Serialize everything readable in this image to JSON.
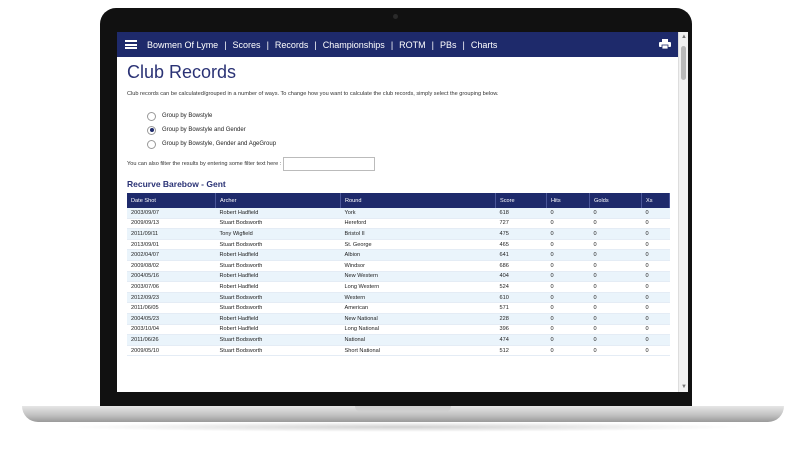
{
  "nav": {
    "brand": "Bowmen Of Lyme",
    "items": [
      "Scores",
      "Records",
      "Championships",
      "ROTM",
      "PBs",
      "Charts"
    ]
  },
  "page": {
    "title": "Club Records",
    "intro": "Club records can be calculated/grouped in a number of ways. To change how you want to calculate the club records, simply select the grouping below."
  },
  "grouping": {
    "options": [
      {
        "label": "Group by Bowstyle",
        "selected": false
      },
      {
        "label": "Group by Bowstyle and Gender",
        "selected": true
      },
      {
        "label": "Group by Bowstyle, Gender and AgeGroup",
        "selected": false
      }
    ]
  },
  "filter": {
    "label": "You can also filter the results by entering some filter text here :",
    "value": ""
  },
  "section": {
    "title": "Recurve Barebow - Gent"
  },
  "table": {
    "columns": [
      "Date Shot",
      "Archer",
      "Round",
      "Score",
      "Hits",
      "Golds",
      "Xs"
    ],
    "rows": [
      [
        "2003/09/07",
        "Robert Hadfield",
        "York",
        "618",
        "0",
        "0",
        "0"
      ],
      [
        "2009/09/13",
        "Stuart Bodsworth",
        "Hereford",
        "727",
        "0",
        "0",
        "0"
      ],
      [
        "2011/09/11",
        "Tony Wigfield",
        "Bristol II",
        "475",
        "0",
        "0",
        "0"
      ],
      [
        "2013/09/01",
        "Stuart Bodsworth",
        "St. George",
        "465",
        "0",
        "0",
        "0"
      ],
      [
        "2002/04/07",
        "Robert Hadfield",
        "Albion",
        "641",
        "0",
        "0",
        "0"
      ],
      [
        "2009/08/02",
        "Stuart Bodsworth",
        "Windsor",
        "686",
        "0",
        "0",
        "0"
      ],
      [
        "2004/05/16",
        "Robert Hadfield",
        "New Western",
        "404",
        "0",
        "0",
        "0"
      ],
      [
        "2003/07/06",
        "Robert Hadfield",
        "Long Western",
        "524",
        "0",
        "0",
        "0"
      ],
      [
        "2012/09/23",
        "Stuart Bodsworth",
        "Western",
        "610",
        "0",
        "0",
        "0"
      ],
      [
        "2011/06/05",
        "Stuart Bodsworth",
        "American",
        "571",
        "0",
        "0",
        "0"
      ],
      [
        "2004/05/23",
        "Robert Hadfield",
        "New National",
        "228",
        "0",
        "0",
        "0"
      ],
      [
        "2003/10/04",
        "Robert Hadfield",
        "Long National",
        "396",
        "0",
        "0",
        "0"
      ],
      [
        "2011/06/26",
        "Stuart Bodsworth",
        "National",
        "474",
        "0",
        "0",
        "0"
      ],
      [
        "2009/05/10",
        "Stuart Bodsworth",
        "Short National",
        "512",
        "0",
        "0",
        "0"
      ]
    ]
  },
  "colors": {
    "navbar": "#1e2a6b",
    "title": "#2a3275",
    "row_alt": "#eaf4fb"
  },
  "icons": {
    "menu": "hamburger-icon",
    "print": "printer-icon"
  }
}
